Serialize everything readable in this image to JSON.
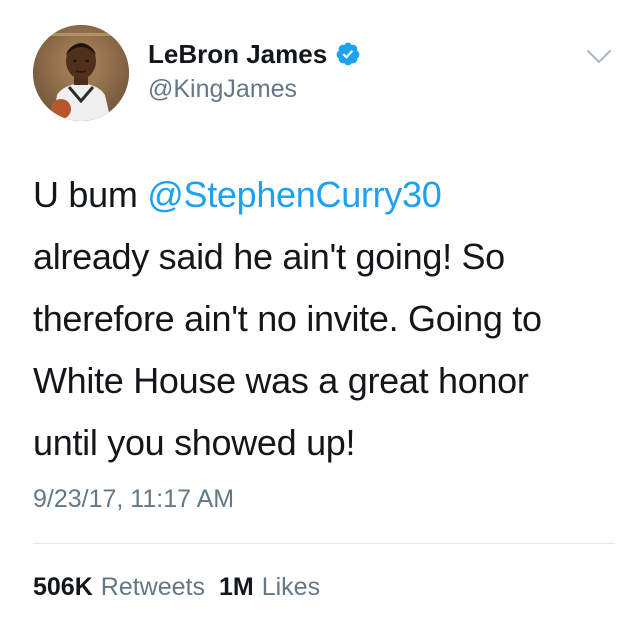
{
  "user": {
    "name": "LeBron James",
    "handle": "@KingJames",
    "verified": true
  },
  "tweet": {
    "lines": [
      {
        "prefix": "U bum ",
        "mention": "@StephenCurry30"
      },
      {
        "text": "already said he ain't going! So"
      },
      {
        "text": "therefore ain't no invite. Going to"
      },
      {
        "text": "White House was a great honor"
      },
      {
        "text": "until you showed up!"
      }
    ],
    "timestamp": "9/23/17, 11:17 AM"
  },
  "stats": {
    "retweets_count": "506K",
    "retweets_label": "Retweets",
    "likes_count": "1M",
    "likes_label": "Likes"
  },
  "icons": {
    "verified": "verified-badge-icon",
    "menu": "chevron-down-icon"
  },
  "colors": {
    "mention": "#1da1f2",
    "secondary_text": "#657786",
    "verified_badge": "#1da1f2"
  }
}
